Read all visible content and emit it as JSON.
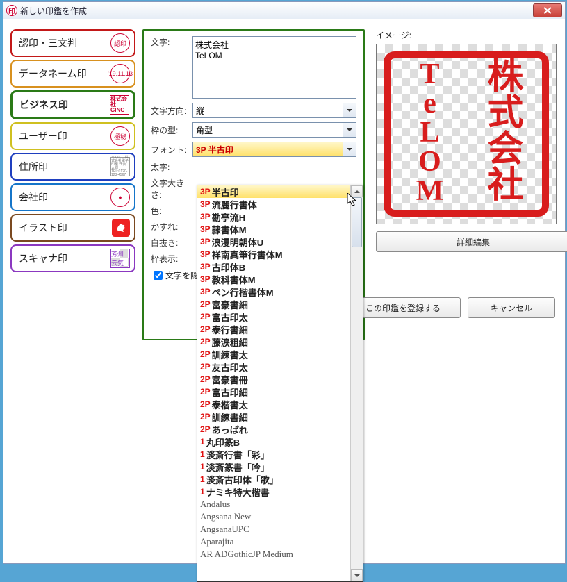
{
  "window": {
    "title": "新しい印鑑を作成",
    "close_tooltip": "閉じる"
  },
  "tabs": [
    {
      "label": "認印・三文判",
      "style": "red",
      "thumb": "認印"
    },
    {
      "label": "データネーム印",
      "style": "orange",
      "thumb": "'19.11.13"
    },
    {
      "label": "ビジネス印",
      "style": "green",
      "thumb": "株式会社\nGING",
      "active": true
    },
    {
      "label": "ユーザー印",
      "style": "yellow",
      "thumb": "極秘"
    },
    {
      "label": "住所印",
      "style": "blue2",
      "thumb": "〒123… 株式会社電子印鑑 代表 太郎 TEL:0120-123-4567"
    },
    {
      "label": "会社印",
      "style": "blue",
      "thumb": "●"
    },
    {
      "label": "イラスト印",
      "style": "brown",
      "thumb": "rooster"
    },
    {
      "label": "スキャナ印",
      "style": "purple",
      "thumb": "芳州\n云気"
    }
  ],
  "form": {
    "text_label": "文字:",
    "text_value": "株式会社\nTeLOM",
    "direction_label": "文字方向:",
    "direction_value": "縦",
    "frame_label": "枠の型:",
    "frame_value": "角型",
    "font_label": "フォント:",
    "font_value": "3P 半古印",
    "weight_label": "太字:",
    "size_label": "文字大きさ:",
    "color_label": "色:",
    "blur_label": "かすれ:",
    "cutout_label": "白抜き:",
    "frame_disp_label": "枠表示:",
    "hide_check_label": "文字を隠す"
  },
  "preview": {
    "label": "イメージ:",
    "col1": [
      "株",
      "式",
      "会",
      "社"
    ],
    "col2": [
      "T",
      "e",
      "L",
      "O",
      "M"
    ],
    "detail_btn": "詳細編集",
    "register_btn": "この印鑑を登録する",
    "cancel_btn": "キャンセル"
  },
  "dropdown": {
    "selected_index": 0,
    "items": [
      {
        "prefix": "3P",
        "name": "半古印"
      },
      {
        "prefix": "3P",
        "name": "流麗行書体"
      },
      {
        "prefix": "3P",
        "name": "勘亭流H"
      },
      {
        "prefix": "3P",
        "name": "隷書体M"
      },
      {
        "prefix": "3P",
        "name": "浪漫明朝体U"
      },
      {
        "prefix": "3P",
        "name": "祥南真筆行書体M"
      },
      {
        "prefix": "3P",
        "name": "古印体B"
      },
      {
        "prefix": "3P",
        "name": "教科書体M"
      },
      {
        "prefix": "3P",
        "name": "ペン行楷書体M"
      },
      {
        "prefix": "2P",
        "name": "富豪書細"
      },
      {
        "prefix": "2P",
        "name": "富古印太"
      },
      {
        "prefix": "2P",
        "name": "泰行書細"
      },
      {
        "prefix": "2P",
        "name": "藤涙粗細"
      },
      {
        "prefix": "2P",
        "name": "訓練書太"
      },
      {
        "prefix": "2P",
        "name": "友古印太"
      },
      {
        "prefix": "2P",
        "name": "富豪書冊"
      },
      {
        "prefix": "2P",
        "name": "富古印細"
      },
      {
        "prefix": "2P",
        "name": "泰楷書太"
      },
      {
        "prefix": "2P",
        "name": "訓練書細"
      },
      {
        "prefix": "2P",
        "name": "あっぱれ"
      },
      {
        "prefix": "1",
        "name": "丸印篆B"
      },
      {
        "prefix": "1",
        "name": "淡斎行書「彩」"
      },
      {
        "prefix": "1",
        "name": "淡斎篆書「吟」"
      },
      {
        "prefix": "1",
        "name": "淡斎古印体「歌」"
      },
      {
        "prefix": "1",
        "name": "ナミキ特大楷書"
      },
      {
        "prefix": "",
        "name": "Andalus",
        "gray": true
      },
      {
        "prefix": "",
        "name": "Angsana New",
        "gray": true
      },
      {
        "prefix": "",
        "name": "AngsanaUPC",
        "gray": true
      },
      {
        "prefix": "",
        "name": "Aparajita",
        "gray": true
      },
      {
        "prefix": "",
        "name": "AR ADGothicJP Medium",
        "gray": true
      }
    ]
  }
}
